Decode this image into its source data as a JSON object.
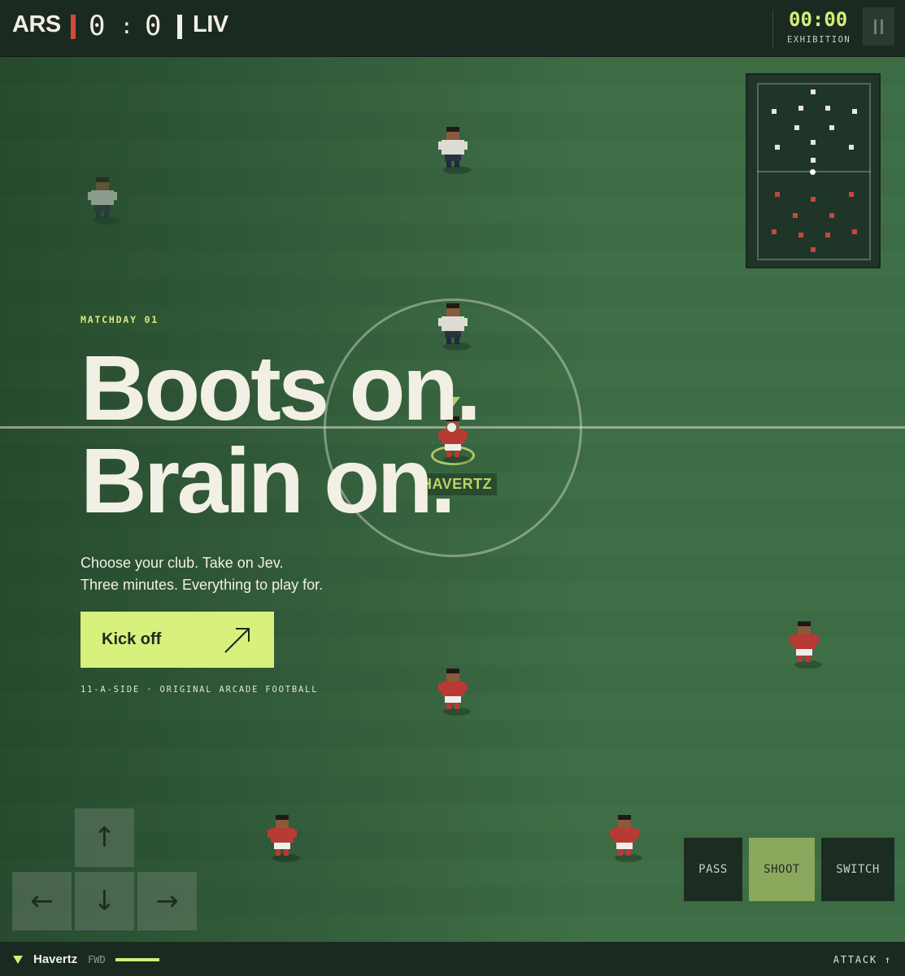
{
  "scoreboard": {
    "home_team": "ARS",
    "away_team": "LIV",
    "home_score": "0",
    "separator": ":",
    "away_score": "0",
    "home_color": "#d24a3c",
    "away_color": "#f2efe4",
    "clock": "00:00",
    "match_type": "EXHIBITION",
    "pause_icon": "pause-icon"
  },
  "hero": {
    "kicker": "MATCHDAY 01",
    "headline_line1": "Boots on.",
    "headline_line2": "Brain on.",
    "subtitle_line1": "Choose your club. Take on Jev.",
    "subtitle_line2": "Three minutes. Everything to play for.",
    "cta_label": "Kick off",
    "cta_icon": "arrow-up-right-icon",
    "tagline": "11-A-SIDE · ORIGINAL ARCADE FOOTBALL"
  },
  "pitch": {
    "selected_player_tag": "HAVERTZ",
    "home_kit": "#b83a34",
    "away_kit": "#dcdcd4"
  },
  "controls": {
    "dpad_up": "↑",
    "dpad_left": "←",
    "dpad_down": "↓",
    "dpad_right": "→",
    "pass": "PASS",
    "shoot": "SHOOT",
    "switch": "SWITCH"
  },
  "status_bar": {
    "active_player": "Havertz",
    "position": "FWD",
    "stamina": 1.0,
    "mode": "ATTACK ↑"
  },
  "colors": {
    "accent": "#d6ec7a",
    "cta_bg": "#d8f07c",
    "shoot_bg": "#8ca85c",
    "bar_bg": "#1a2a21"
  }
}
